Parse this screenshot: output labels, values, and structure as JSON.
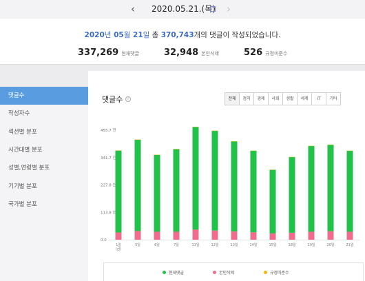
{
  "date_nav": {
    "prev_icon": "chevron-left-icon",
    "date": "2020.05.21.(목)",
    "calendar_icon": "calendar-icon",
    "next_icon": "chevron-right-icon"
  },
  "summary": {
    "year": "2020",
    "year_unit": "년",
    "month": " 05",
    "month_unit": "월",
    "day": " 21",
    "day_unit": "일",
    "total_prefix": " 총 ",
    "total": "370,743",
    "suffix": "개의 댓글이 작성되었습니다.",
    "stats": [
      {
        "value": "337,269",
        "label": "현재댓글"
      },
      {
        "value": "32,948",
        "label": "본인삭제"
      },
      {
        "value": "526",
        "label": "규정미준수"
      }
    ]
  },
  "sidebar": {
    "items": [
      {
        "label": "댓글수",
        "active": true
      },
      {
        "label": "작성자수",
        "active": false
      },
      {
        "label": "섹션별 분포",
        "active": false
      },
      {
        "label": "시간대별 분포",
        "active": false
      },
      {
        "label": "성별,연령별 분포",
        "active": false
      },
      {
        "label": "기기별 분포",
        "active": false
      },
      {
        "label": "국가별 분포",
        "active": false
      }
    ]
  },
  "main": {
    "title": "댓글수",
    "info_icon": "info-icon",
    "filters": [
      {
        "label": "전체",
        "active": true
      },
      {
        "label": "정치",
        "active": false
      },
      {
        "label": "경제",
        "active": false
      },
      {
        "label": "사회",
        "active": false
      },
      {
        "label": "생활",
        "active": false
      },
      {
        "label": "세계",
        "active": false
      },
      {
        "label": "IT",
        "active": false
      },
      {
        "label": "기타",
        "active": false
      }
    ]
  },
  "colors": {
    "current": "#22c24a",
    "deleted": "#f06b8c",
    "violation": "#f2b705",
    "accent": "#3c6bc3",
    "active_tab": "#5a9ce0"
  },
  "chart_data": {
    "type": "bar",
    "stacked": true,
    "categories": [
      "1일\n(금)",
      "5일",
      "6일",
      "7일",
      "11일",
      "12일",
      "13일",
      "14일",
      "15일",
      "18일",
      "19일",
      "20일",
      "21일"
    ],
    "tick_labels": [
      "455.7 천",
      "341.7 천",
      "227.8 천",
      "113.8 천",
      "0.0"
    ],
    "ylim": [
      0,
      455.7
    ],
    "yunit": "천",
    "series": [
      {
        "name": "현재댓글",
        "color": "#22c24a",
        "values": [
          341,
          380,
          320,
          344,
          427,
          415,
          375,
          339,
          265,
          315,
          357,
          360,
          337
        ]
      },
      {
        "name": "본인삭제",
        "color": "#f06b8c",
        "values": [
          30,
          36,
          33,
          33,
          42,
          38,
          34,
          31,
          26,
          29,
          33,
          35,
          33
        ]
      },
      {
        "name": "규정미준수",
        "color": "#f2b705",
        "values": [
          0.5,
          0.6,
          0.5,
          0.5,
          0.7,
          0.6,
          0.6,
          0.5,
          0.4,
          0.5,
          0.5,
          0.6,
          0.5
        ]
      }
    ],
    "grid": false,
    "legend": "bottom"
  }
}
